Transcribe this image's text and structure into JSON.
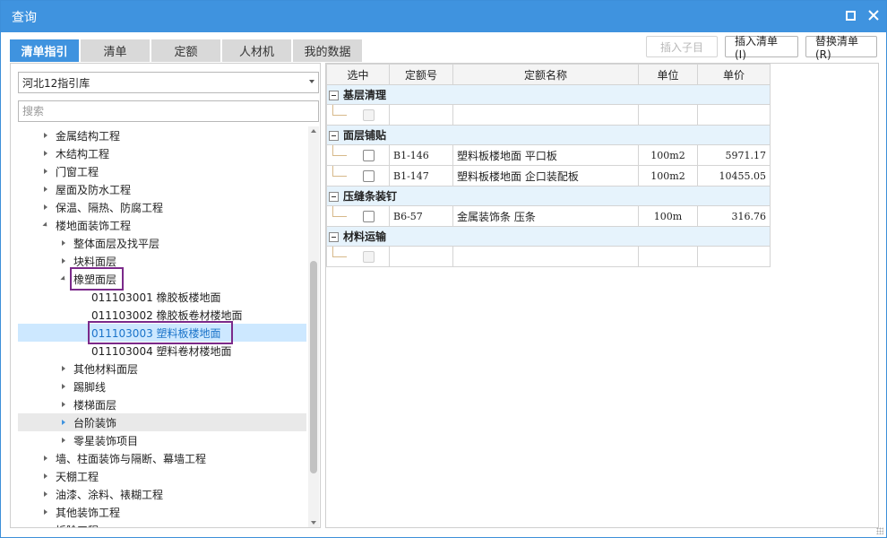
{
  "window": {
    "title": "查询"
  },
  "tabs": [
    {
      "label": "清单指引",
      "active": true
    },
    {
      "label": "清单"
    },
    {
      "label": "定额"
    },
    {
      "label": "人材机"
    },
    {
      "label": "我的数据"
    }
  ],
  "toolbar": {
    "insert_sub": "插入子目",
    "insert_list": "插入清单(I)",
    "replace_list": "替换清单(R)"
  },
  "left": {
    "library_selected": "河北12指引库",
    "search_placeholder": "搜索",
    "tree": [
      {
        "label": "金属结构工程",
        "level": 0,
        "state": "collapsed"
      },
      {
        "label": "木结构工程",
        "level": 0,
        "state": "collapsed"
      },
      {
        "label": "门窗工程",
        "level": 0,
        "state": "collapsed"
      },
      {
        "label": "屋面及防水工程",
        "level": 0,
        "state": "collapsed"
      },
      {
        "label": "保温、隔热、防腐工程",
        "level": 0,
        "state": "collapsed"
      },
      {
        "label": "楼地面装饰工程",
        "level": 0,
        "state": "expanded"
      },
      {
        "label": "整体面层及找平层",
        "level": 1,
        "state": "collapsed"
      },
      {
        "label": "块料面层",
        "level": 1,
        "state": "collapsed"
      },
      {
        "label": "橡塑面层",
        "level": 1,
        "state": "expanded",
        "boxed": true
      },
      {
        "label": "011103001  橡胶板楼地面",
        "level": 2,
        "state": "leaf"
      },
      {
        "label": "011103002  橡胶板卷材楼地面",
        "level": 2,
        "state": "leaf"
      },
      {
        "label": "011103003  塑料板楼地面",
        "level": 2,
        "state": "leaf",
        "selected": true,
        "boxed": true
      },
      {
        "label": "011103004  塑料卷材楼地面",
        "level": 2,
        "state": "leaf"
      },
      {
        "label": "其他材料面层",
        "level": 1,
        "state": "collapsed"
      },
      {
        "label": "踢脚线",
        "level": 1,
        "state": "collapsed"
      },
      {
        "label": "楼梯面层",
        "level": 1,
        "state": "collapsed"
      },
      {
        "label": "台阶装饰",
        "level": 1,
        "state": "collapsed",
        "hover": true
      },
      {
        "label": "零星装饰项目",
        "level": 1,
        "state": "collapsed"
      },
      {
        "label": "墙、柱面装饰与隔断、幕墙工程",
        "level": 0,
        "state": "collapsed"
      },
      {
        "label": "天棚工程",
        "level": 0,
        "state": "collapsed"
      },
      {
        "label": "油漆、涂料、裱糊工程",
        "level": 0,
        "state": "collapsed"
      },
      {
        "label": "其他装饰工程",
        "level": 0,
        "state": "collapsed"
      },
      {
        "label": "拆除工程",
        "level": 0,
        "state": "collapsed"
      }
    ]
  },
  "grid": {
    "headers": [
      "选中",
      "定额号",
      "定额名称",
      "单位",
      "单价"
    ],
    "groups": [
      {
        "name": "基层清理",
        "rows": [
          {
            "code": "",
            "name": "",
            "unit": "",
            "price": "",
            "disabled": true
          }
        ]
      },
      {
        "name": "面层铺贴",
        "rows": [
          {
            "code": "B1-146",
            "name": "塑料板楼地面 平口板",
            "unit": "100m2",
            "price": "5971.17"
          },
          {
            "code": "B1-147",
            "name": "塑料板楼地面 企口装配板",
            "unit": "100m2",
            "price": "10455.05"
          }
        ]
      },
      {
        "name": "压缝条装钉",
        "rows": [
          {
            "code": "B6-57",
            "name": "金属装饰条 压条",
            "unit": "100m",
            "price": "316.76"
          }
        ]
      },
      {
        "name": "材料运输",
        "rows": [
          {
            "code": "",
            "name": "",
            "unit": "",
            "price": "",
            "disabled": true
          }
        ]
      }
    ]
  }
}
